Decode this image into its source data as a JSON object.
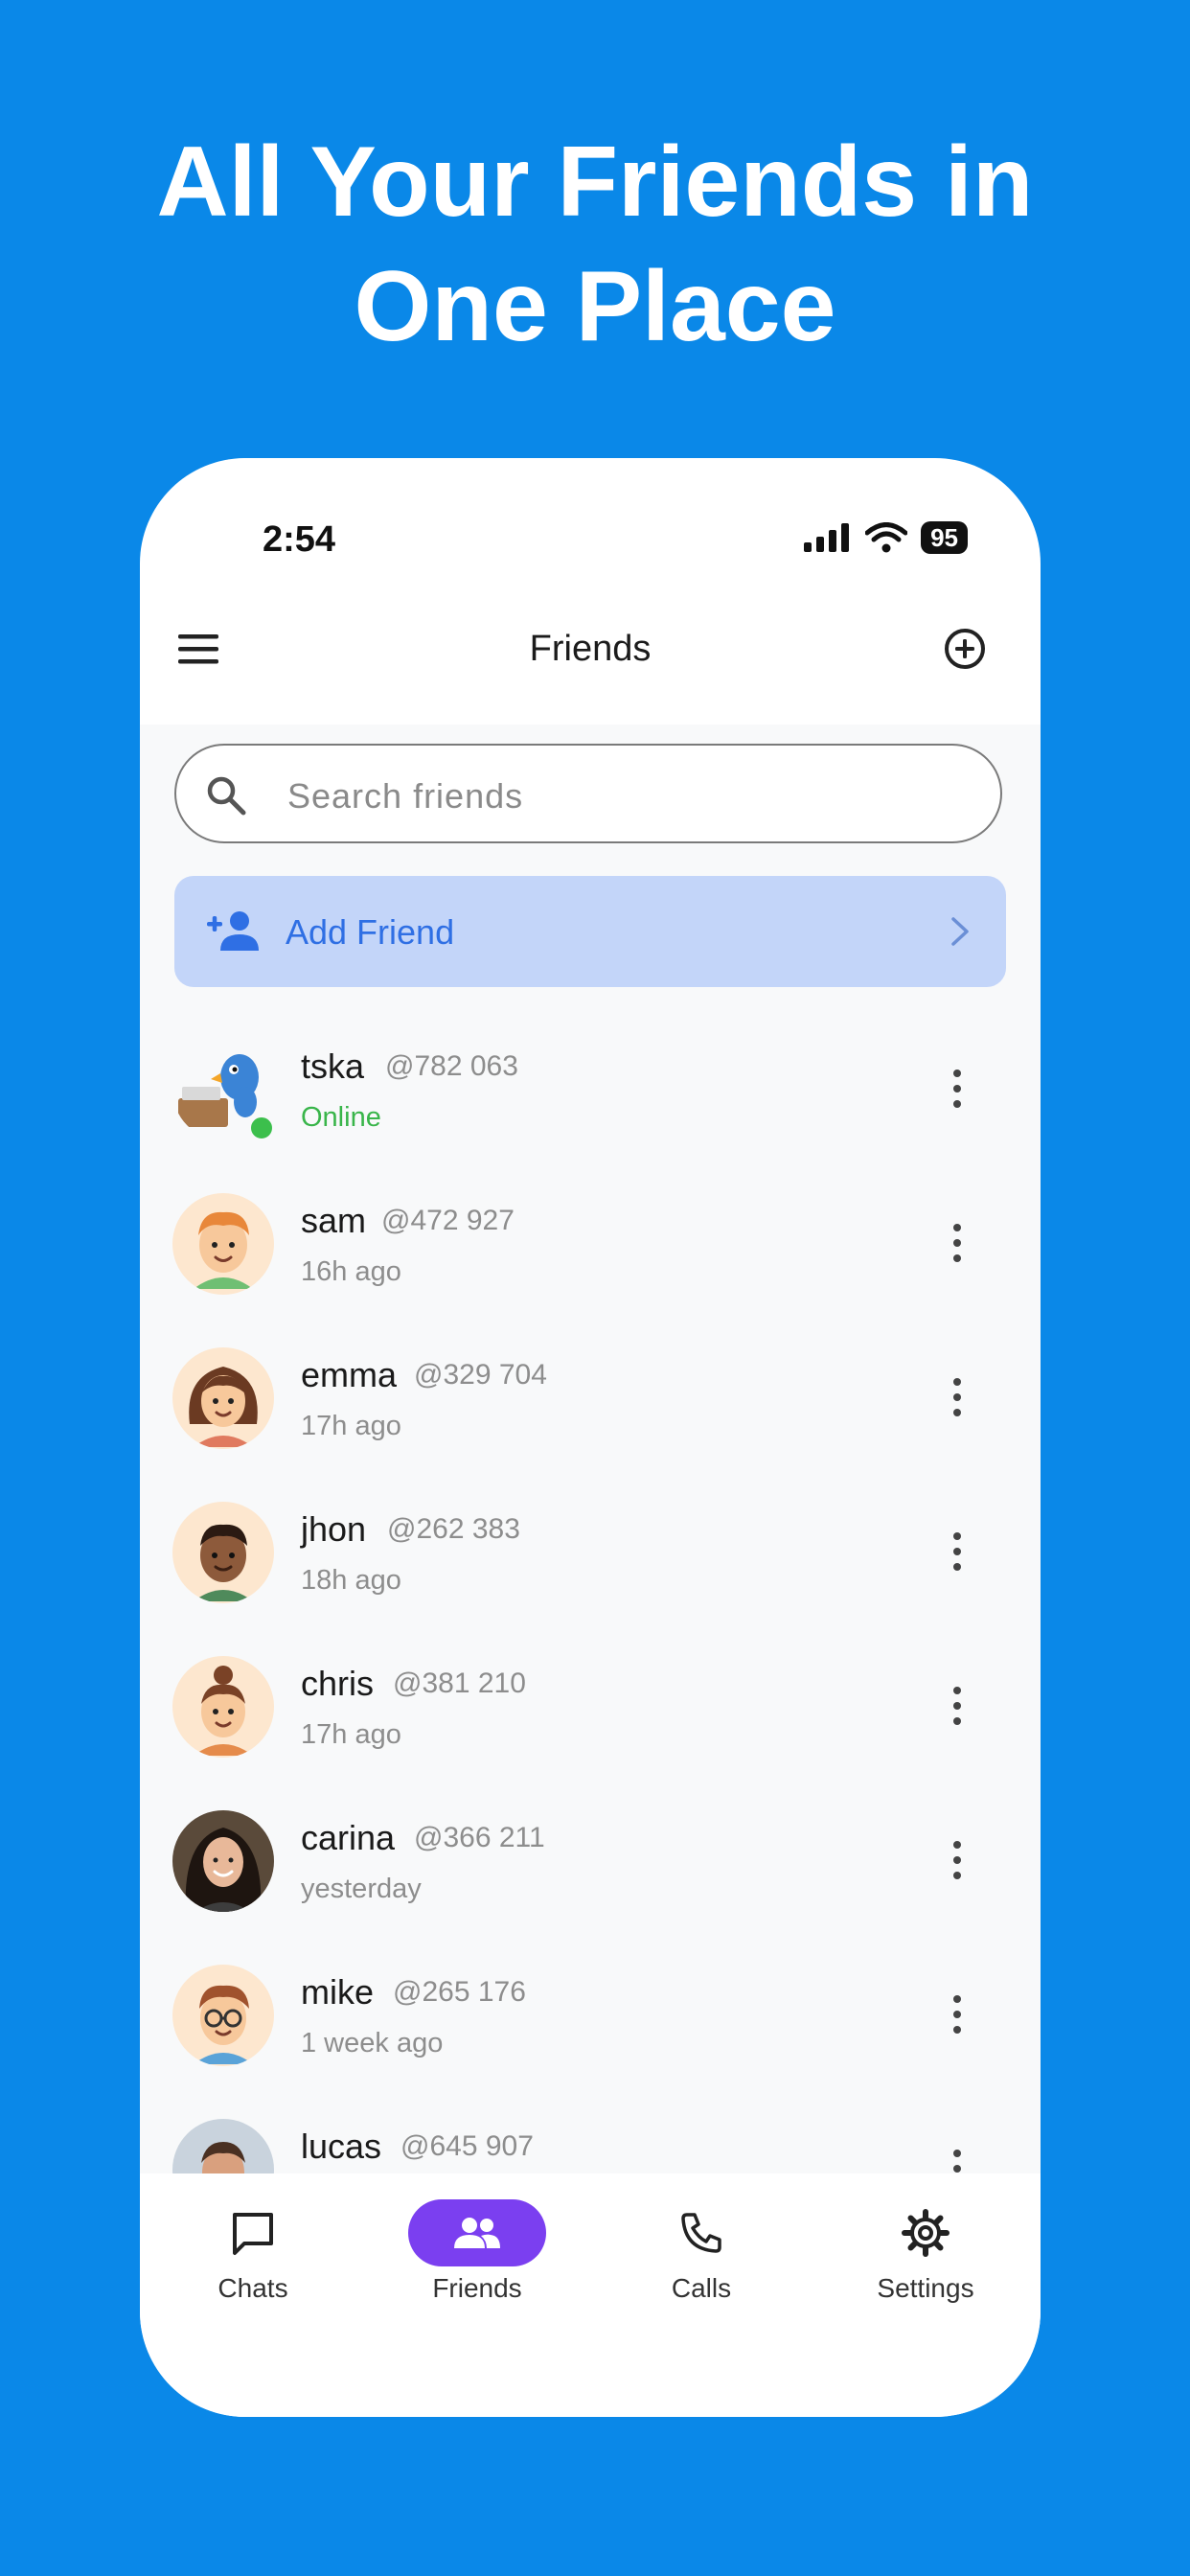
{
  "headline": {
    "line1": "All Your Friends in",
    "line2": "One Place"
  },
  "status_bar": {
    "time": "2:54",
    "battery": "95"
  },
  "app_bar": {
    "title": "Friends"
  },
  "search": {
    "placeholder": "Search friends"
  },
  "add_friend": {
    "label": "Add Friend"
  },
  "friends": [
    {
      "name": "tska",
      "handle": "@782 063",
      "status": "Online",
      "online": true,
      "avatar_icon": "parrot-avatar-icon"
    },
    {
      "name": "sam",
      "handle": "@472 927",
      "status": "16h ago",
      "avatar_icon": "boy-avatar-icon"
    },
    {
      "name": "emma",
      "handle": "@329 704",
      "status": "17h ago",
      "avatar_icon": "girl-avatar-icon"
    },
    {
      "name": "jhon",
      "handle": "@262 383",
      "status": "18h ago",
      "avatar_icon": "man-avatar-icon"
    },
    {
      "name": "chris",
      "handle": "@381 210",
      "status": "17h ago",
      "avatar_icon": "bun-avatar-icon"
    },
    {
      "name": "carina",
      "handle": "@366 211",
      "status": "yesterday",
      "avatar_icon": "photo-avatar-icon"
    },
    {
      "name": "mike",
      "handle": "@265 176",
      "status": "1 week ago",
      "avatar_icon": "glasses-avatar-icon"
    },
    {
      "name": "lucas",
      "handle": "@645 907",
      "status": "",
      "avatar_icon": "photo-avatar-icon"
    }
  ],
  "bottom_nav": [
    {
      "label": "Chats",
      "icon": "chat-icon",
      "active": false
    },
    {
      "label": "Friends",
      "icon": "friends-icon",
      "active": true
    },
    {
      "label": "Calls",
      "icon": "phone-icon",
      "active": false
    },
    {
      "label": "Settings",
      "icon": "gear-icon",
      "active": false
    }
  ],
  "colors": {
    "background": "#0a88e8",
    "accent": "#7b3ff0",
    "add_friend_bg": "#c3d5f9",
    "add_friend_text": "#2f6fe4",
    "online": "#39b54a"
  }
}
